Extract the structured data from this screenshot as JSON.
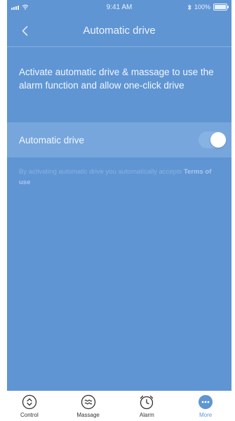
{
  "status_bar": {
    "time": "9:41 AM",
    "battery_text": "100%",
    "battery_level": 1.0
  },
  "nav": {
    "title": "Automatic drive",
    "back_icon": "chevron-left-icon"
  },
  "description": "Activate automatic drive & massage to use the alarm function and allow one-click drive",
  "toggle": {
    "label": "Automatic drive",
    "on": true
  },
  "footnote": {
    "text": "By activating automatic drive you automatically accepts ",
    "link": "Terms of use"
  },
  "tabs": [
    {
      "label": "Control",
      "icon": "control-icon",
      "active": false
    },
    {
      "label": "Massage",
      "icon": "massage-icon",
      "active": false
    },
    {
      "label": "Alarm",
      "icon": "alarm-clock-icon",
      "active": false
    },
    {
      "label": "More",
      "icon": "more-icon",
      "active": true
    }
  ],
  "colors": {
    "primary": "#5f95d3",
    "row_highlight": "#77a6dc",
    "tab_active": "#5f95d3",
    "tab_inactive": "#333333"
  }
}
